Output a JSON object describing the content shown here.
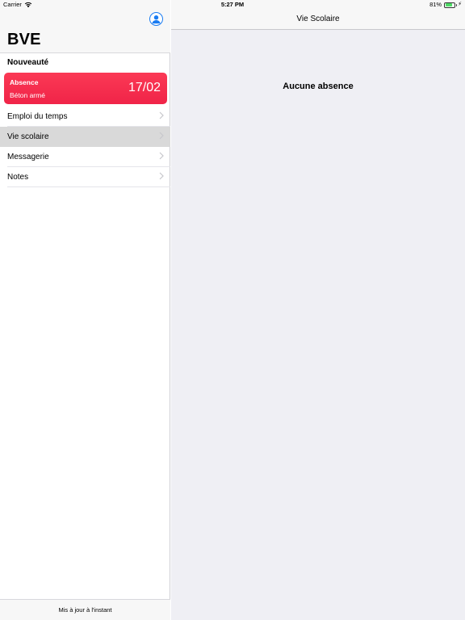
{
  "status_bar": {
    "carrier": "Carrier",
    "time": "5:27 PM",
    "battery": "81%",
    "battery_level": 0.81
  },
  "master": {
    "title": "BVE",
    "section_header": "Nouveauté",
    "news_card": {
      "title": "Absence",
      "subtitle": "Béton armé",
      "date": "17/02",
      "color": "#f02448"
    },
    "menu": [
      {
        "label": "Emploi du temps",
        "selected": false
      },
      {
        "label": "Vie scolaire",
        "selected": true
      },
      {
        "label": "Messagerie",
        "selected": false
      },
      {
        "label": "Notes",
        "selected": false
      }
    ],
    "footer": "Mis à jour à l'instant"
  },
  "detail": {
    "title": "Vie Scolaire",
    "empty_message": "Aucune absence"
  },
  "colors": {
    "accent": "#1a7cf2",
    "selected_row": "#d9d9d9",
    "detail_background": "#efeff4"
  },
  "icons": {
    "profile": "user-circle-icon",
    "chevron": "chevron-right-icon",
    "wifi": "wifi-icon",
    "battery": "battery-icon",
    "charging": "bolt-icon"
  }
}
